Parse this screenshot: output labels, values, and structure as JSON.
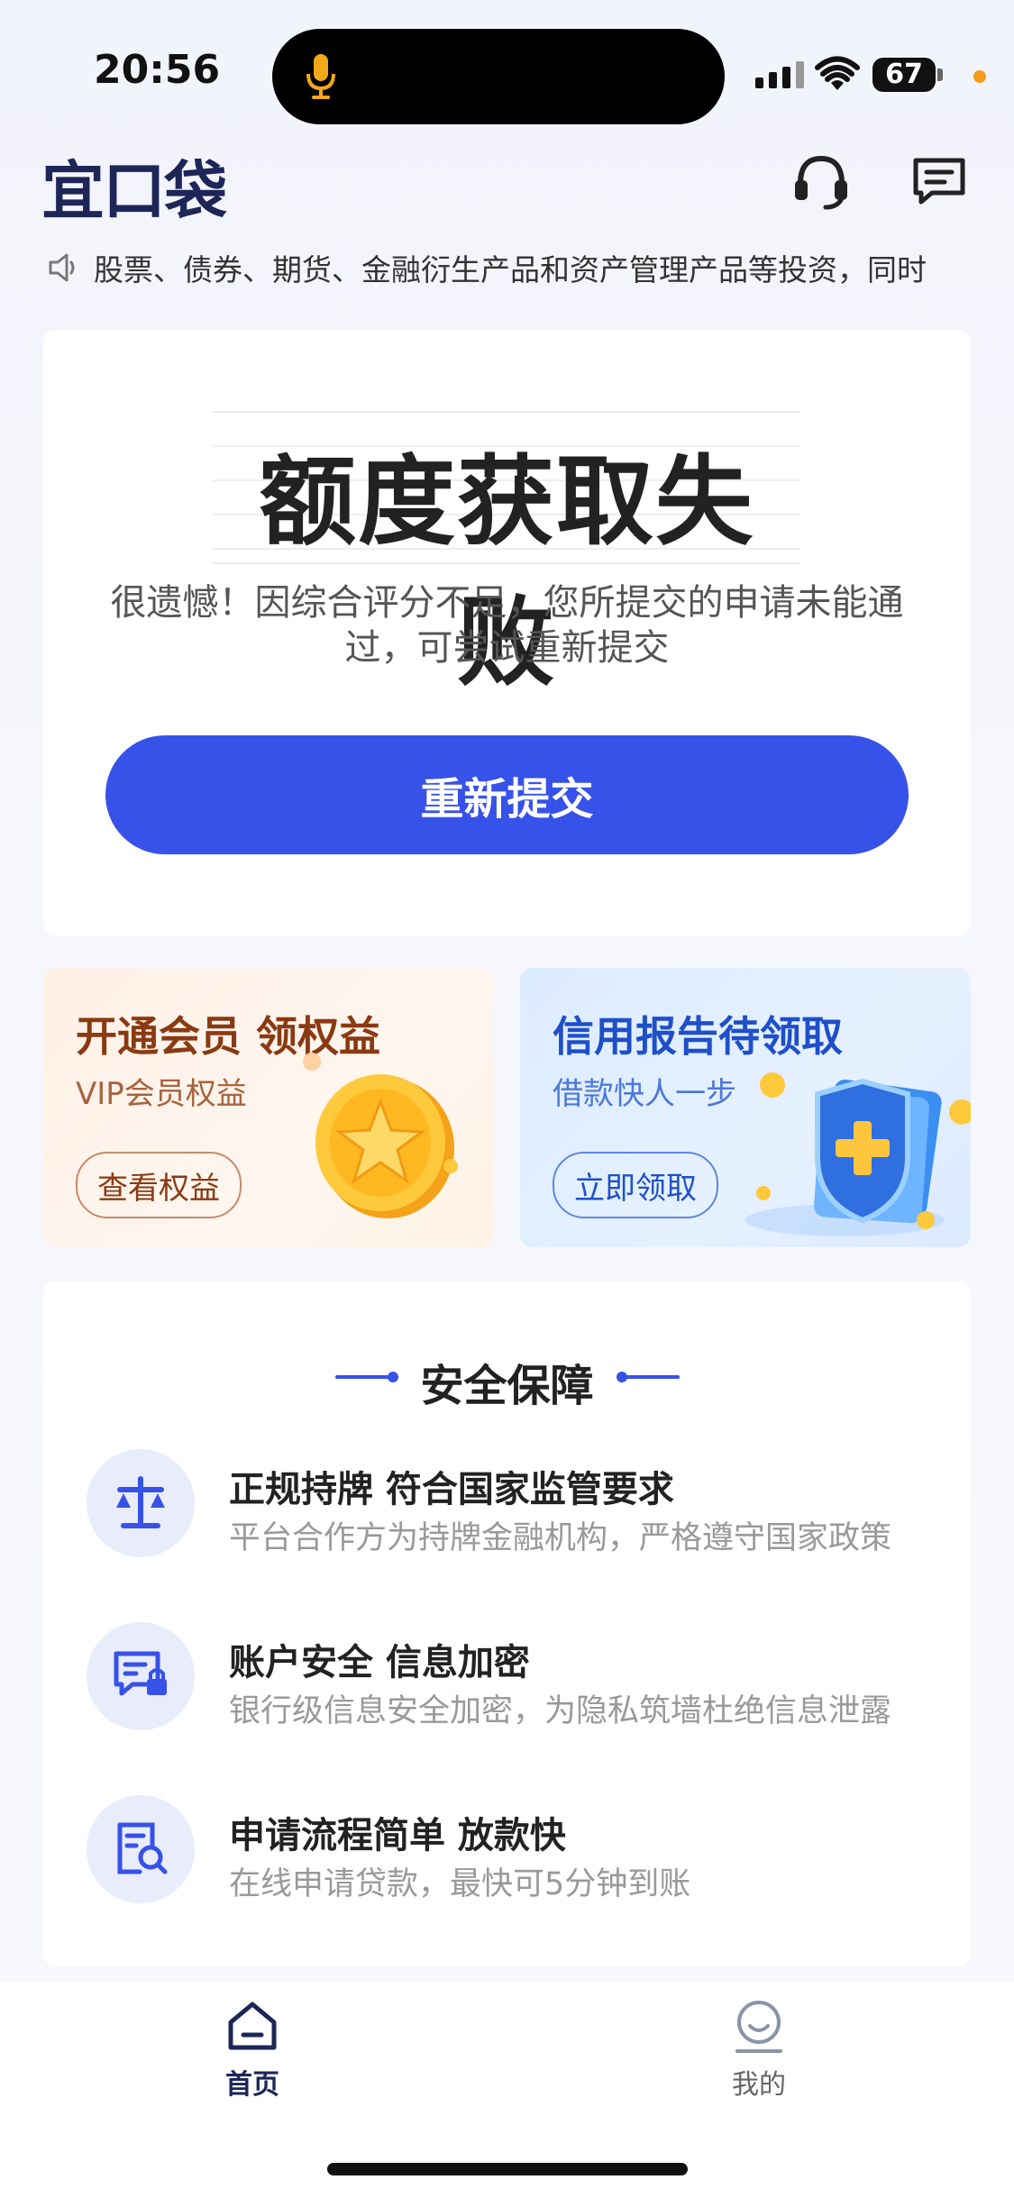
{
  "status_bar": {
    "time": "20:56",
    "battery": "67"
  },
  "header": {
    "logo": "宜口袋"
  },
  "notice": {
    "text": "股票、债券、期货、金融衍生产品和资产管理产品等投资，同时"
  },
  "result": {
    "title": "额度获取失败",
    "description": "很遗憾！因综合评分不足，您所提交的申请未能通过，可尝试重新提交",
    "button": "重新提交"
  },
  "promos": [
    {
      "title": "开通会员 领权益",
      "subtitle": "VIP会员权益",
      "button": "查看权益",
      "icon": "gold-star-coin"
    },
    {
      "title": "信用报告待领取",
      "subtitle": "借款快人一步",
      "button": "立即领取",
      "icon": "shield-report"
    }
  ],
  "security": {
    "title": "安全保障",
    "features": [
      {
        "title": "正规持牌 符合国家监管要求",
        "desc": "平台合作方为持牌金融机构，严格遵守国家政策",
        "icon": "scale-icon"
      },
      {
        "title": "账户安全 信息加密",
        "desc": "银行级信息安全加密，为隐私筑墙杜绝信息泄露",
        "icon": "secure-message-icon"
      },
      {
        "title": "申请流程简单 放款快",
        "desc": "在线申请贷款，最快可5分钟到账",
        "icon": "document-search-icon"
      }
    ]
  },
  "nav": {
    "home": "首页",
    "mine": "我的"
  },
  "colors": {
    "primary": "#3752e8",
    "brand_dark": "#1d2657"
  }
}
